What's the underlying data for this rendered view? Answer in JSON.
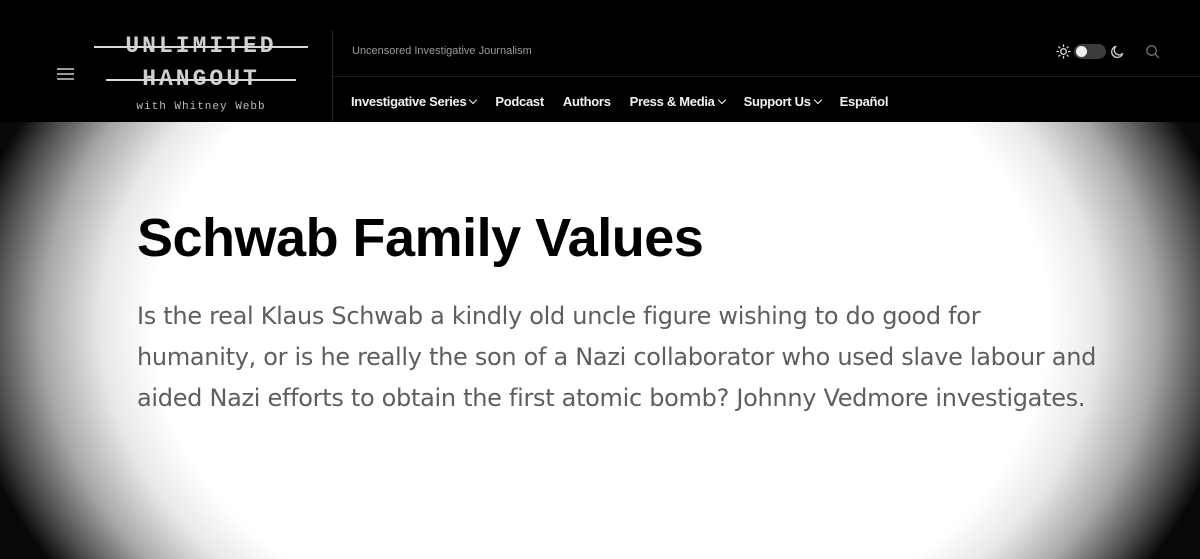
{
  "header": {
    "logo": {
      "line1": "UNLIMITED",
      "line2": "HANGOUT",
      "subtitle": "with Whitney Webb"
    },
    "tagline": "Uncensored Investigative Journalism",
    "nav": [
      {
        "label": "Investigative Series",
        "has_dropdown": true
      },
      {
        "label": "Podcast",
        "has_dropdown": false
      },
      {
        "label": "Authors",
        "has_dropdown": false
      },
      {
        "label": "Press & Media",
        "has_dropdown": true
      },
      {
        "label": "Support Us",
        "has_dropdown": true
      },
      {
        "label": "Español",
        "has_dropdown": false
      }
    ],
    "theme_toggle": {
      "state": "light"
    },
    "icons": [
      "menu-icon",
      "sun-icon",
      "moon-icon",
      "search-icon"
    ]
  },
  "article": {
    "title": "Schwab Family Values",
    "excerpt": "Is the real Klaus Schwab a kindly old uncle figure wishing to do good for humanity, or is he really the son of a Nazi collaborator who used slave labour and aided Nazi efforts to obtain the first atomic bomb? Johnny Vedmore investigates."
  },
  "colors": {
    "header_bg": "#000000",
    "nav_text": "#f2f2f2",
    "tagline_text": "#9b9b9b",
    "title_text": "#000000",
    "excerpt_text": "#5e5e5e"
  }
}
